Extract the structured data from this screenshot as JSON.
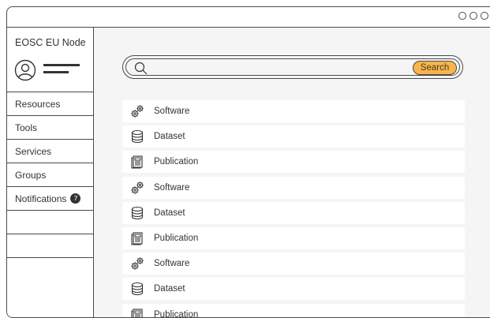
{
  "sidebar": {
    "brand": "EOSC EU Node",
    "nav": [
      {
        "label": "Resources"
      },
      {
        "label": "Tools"
      },
      {
        "label": "Services"
      },
      {
        "label": "Groups"
      },
      {
        "label": "Notifications",
        "badge": "7"
      }
    ]
  },
  "search": {
    "placeholder": "",
    "button_label": "Search",
    "button_color": "#f9b54c"
  },
  "results": [
    {
      "label": "Software",
      "icon": "gears-icon"
    },
    {
      "label": "Dataset",
      "icon": "database-icon"
    },
    {
      "label": "Publication",
      "icon": "document-icon"
    },
    {
      "label": "Software",
      "icon": "gears-icon"
    },
    {
      "label": "Dataset",
      "icon": "database-icon"
    },
    {
      "label": "Publication",
      "icon": "document-icon"
    },
    {
      "label": "Software",
      "icon": "gears-icon"
    },
    {
      "label": "Dataset",
      "icon": "database-icon"
    },
    {
      "label": "Publication",
      "icon": "document-icon"
    }
  ]
}
